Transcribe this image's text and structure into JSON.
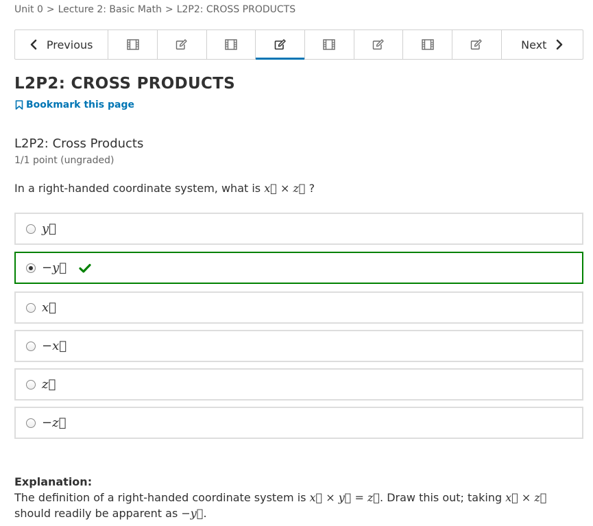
{
  "breadcrumb": {
    "items": [
      "Unit 0",
      "Lecture 2: Basic Math",
      "L2P2: CROSS PRODUCTS"
    ],
    "separator": ">"
  },
  "sequence_nav": {
    "previous_label": "Previous",
    "next_label": "Next",
    "tabs": [
      {
        "icon": "video-icon"
      },
      {
        "icon": "edit-icon"
      },
      {
        "icon": "video-icon"
      },
      {
        "icon": "edit-icon",
        "active": true
      },
      {
        "icon": "video-icon"
      },
      {
        "icon": "edit-icon"
      },
      {
        "icon": "video-icon"
      },
      {
        "icon": "edit-icon"
      }
    ]
  },
  "page": {
    "title": "L2P2: CROSS PRODUCTS",
    "bookmark_label": "Bookmark this page"
  },
  "problem": {
    "title": "L2P2: Cross Products",
    "progress": "1/1 point (ungraded)",
    "question_prefix": "In a right-handed coordinate system, what is",
    "question_math": "x⃗ × z⃗",
    "question_suffix": "?",
    "options": [
      {
        "label": "y⃗",
        "selected": false
      },
      {
        "label": "−y⃗",
        "selected": true,
        "correct": true
      },
      {
        "label": "x⃗",
        "selected": false
      },
      {
        "label": "−x⃗",
        "selected": false
      },
      {
        "label": "z⃗",
        "selected": false
      },
      {
        "label": "−z⃗",
        "selected": false
      }
    ]
  },
  "explanation": {
    "title": "Explanation:",
    "text_1": "The definition of a right-handed coordinate system is",
    "math_1": "x⃗ × y⃗ = z⃗",
    "text_2": ". Draw this out; taking",
    "math_2": "x⃗ × z⃗",
    "text_3": "should readily be apparent as",
    "math_3": "−y⃗",
    "text_4": "."
  },
  "colors": {
    "accent": "#0075b4",
    "correct": "#008100",
    "border": "#dddddd",
    "text": "#313131",
    "muted": "#646464"
  }
}
